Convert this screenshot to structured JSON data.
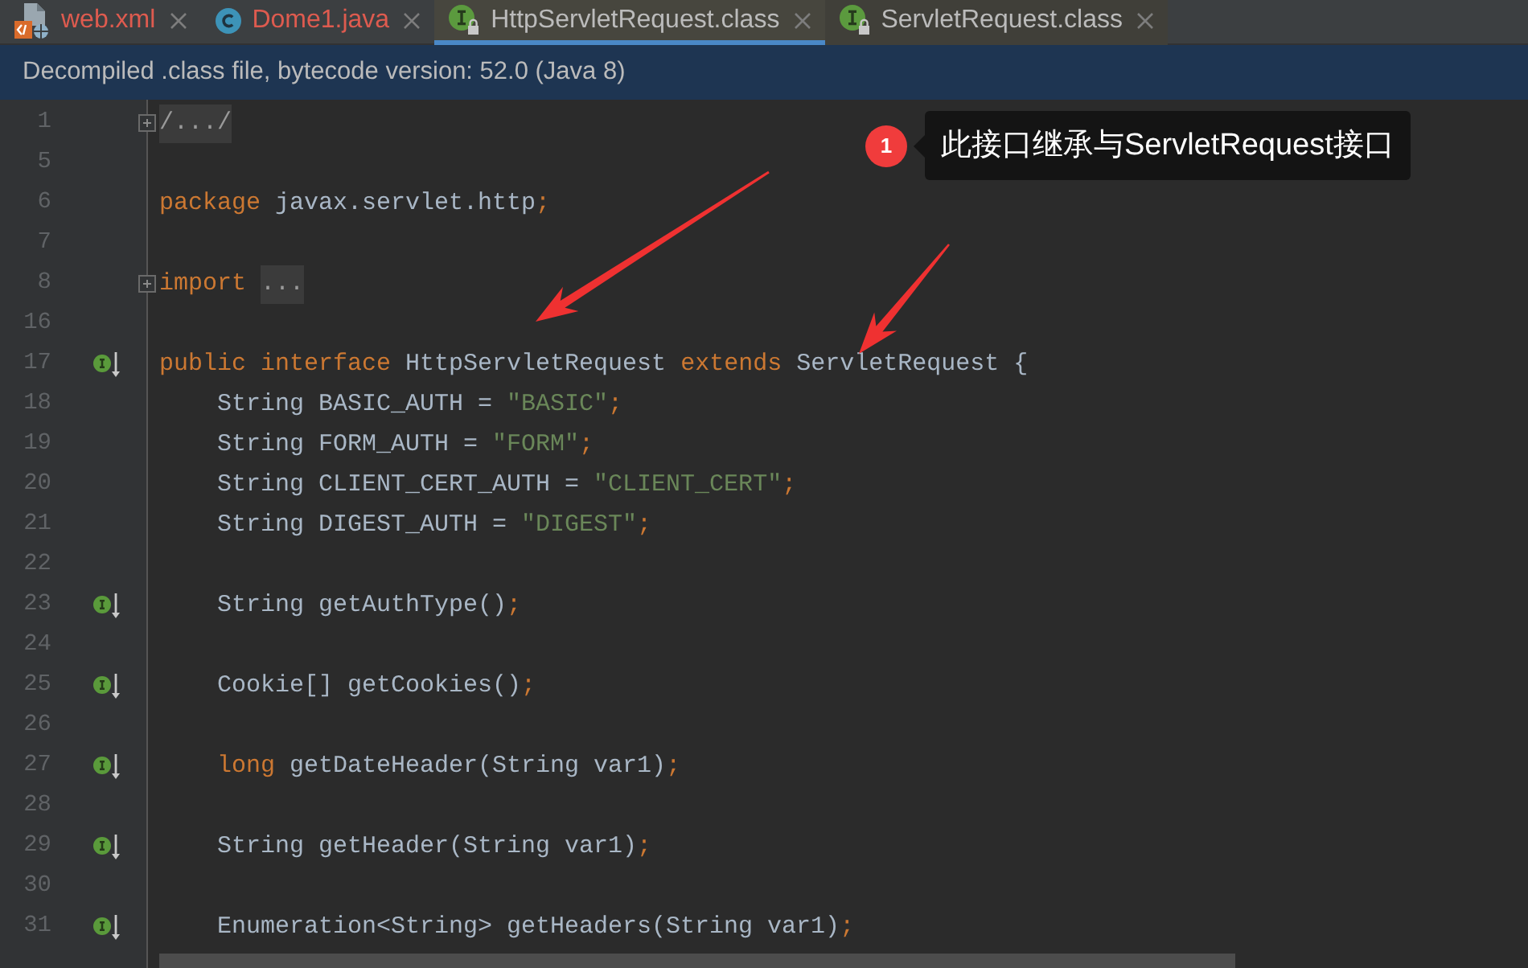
{
  "tabs": [
    {
      "label": "web.xml",
      "kind": "xml",
      "selected": false,
      "error": true,
      "library": false
    },
    {
      "label": "Dome1.java",
      "kind": "java",
      "selected": false,
      "error": true,
      "library": false
    },
    {
      "label": "HttpServletRequest.class",
      "kind": "class",
      "selected": true,
      "error": false,
      "library": true
    },
    {
      "label": "ServletRequest.class",
      "kind": "class",
      "selected": false,
      "error": false,
      "library": true
    }
  ],
  "banner": {
    "text": "Decompiled .class file, bytecode version: 52.0 (Java 8)"
  },
  "editor": {
    "lines": [
      {
        "number": "1",
        "fold": true,
        "marker": false,
        "tokens": [
          {
            "kind": "folded",
            "text": "/.../"
          }
        ]
      },
      {
        "number": "5",
        "fold": false,
        "marker": false
      },
      {
        "number": "6",
        "fold": false,
        "marker": false,
        "tokens": [
          {
            "kind": "keyword",
            "text": "package"
          },
          {
            "kind": "plain",
            "text": " javax.servlet.http"
          },
          {
            "kind": "punctuation",
            "text": ";"
          }
        ]
      },
      {
        "number": "7",
        "fold": false,
        "marker": false
      },
      {
        "number": "8",
        "fold": true,
        "marker": false,
        "tokens": [
          {
            "kind": "keyword",
            "text": "import"
          },
          {
            "kind": "folded",
            "text": "..."
          }
        ]
      },
      {
        "number": "16",
        "fold": false,
        "marker": false
      },
      {
        "number": "17",
        "fold": false,
        "marker": true,
        "tokens": [
          {
            "kind": "keyword",
            "text": "public interface"
          },
          {
            "kind": "plain",
            "text": " HttpServletRequest "
          },
          {
            "kind": "keyword",
            "text": "extends"
          },
          {
            "kind": "plain",
            "text": " ServletRequest {"
          }
        ],
        "children": [
          {
            "number": "18",
            "fold": false,
            "marker": false,
            "tokens": [
              {
                "kind": "plain",
                "text": "String BASIC_AUTH = "
              },
              {
                "kind": "string",
                "text": "\"BASIC\""
              },
              {
                "kind": "punctuation",
                "text": ";"
              }
            ]
          },
          {
            "number": "19",
            "fold": false,
            "marker": false,
            "tokens": [
              {
                "kind": "plain",
                "text": "String FORM_AUTH = "
              },
              {
                "kind": "string",
                "text": "\"FORM\""
              },
              {
                "kind": "punctuation",
                "text": ";"
              }
            ]
          },
          {
            "number": "20",
            "fold": false,
            "marker": false,
            "tokens": [
              {
                "kind": "plain",
                "text": "String CLIENT_CERT_AUTH = "
              },
              {
                "kind": "string",
                "text": "\"CLIENT_CERT\""
              },
              {
                "kind": "punctuation",
                "text": ";"
              }
            ]
          },
          {
            "number": "21",
            "fold": false,
            "marker": false,
            "tokens": [
              {
                "kind": "plain",
                "text": "String DIGEST_AUTH = "
              },
              {
                "kind": "string",
                "text": "\"DIGEST\""
              },
              {
                "kind": "punctuation",
                "text": ";"
              }
            ]
          },
          {
            "number": "22",
            "fold": false,
            "marker": false
          },
          {
            "number": "23",
            "fold": false,
            "marker": true,
            "tokens": [
              {
                "kind": "plain",
                "text": "String getAuthType()"
              },
              {
                "kind": "punctuation",
                "text": ";"
              }
            ]
          },
          {
            "number": "24",
            "fold": false,
            "marker": false
          },
          {
            "number": "25",
            "fold": false,
            "marker": true,
            "tokens": [
              {
                "kind": "plain",
                "text": "Cookie[] getCookies()"
              },
              {
                "kind": "punctuation",
                "text": ";"
              }
            ]
          },
          {
            "number": "26",
            "fold": false,
            "marker": false
          },
          {
            "number": "27",
            "fold": false,
            "marker": true,
            "tokens": [
              {
                "kind": "keyword",
                "text": "long"
              },
              {
                "kind": "plain",
                "text": " getDateHeader(String var1)"
              },
              {
                "kind": "punctuation",
                "text": ";"
              }
            ]
          },
          {
            "number": "28",
            "fold": false,
            "marker": false
          },
          {
            "number": "29",
            "fold": false,
            "marker": true,
            "tokens": [
              {
                "kind": "plain",
                "text": "String getHeader(String var1)"
              },
              {
                "kind": "punctuation",
                "text": ";"
              }
            ]
          },
          {
            "number": "30",
            "fold": false,
            "marker": false
          },
          {
            "number": "31",
            "fold": false,
            "marker": true,
            "tokens": [
              {
                "kind": "plain",
                "text": "Enumeration<String> getHeaders(String var1)"
              },
              {
                "kind": "punctuation",
                "text": ";"
              }
            ]
          }
        ]
      }
    ]
  },
  "annotation": {
    "badge": "1",
    "text": "此接口继承与ServletRequest接口"
  }
}
